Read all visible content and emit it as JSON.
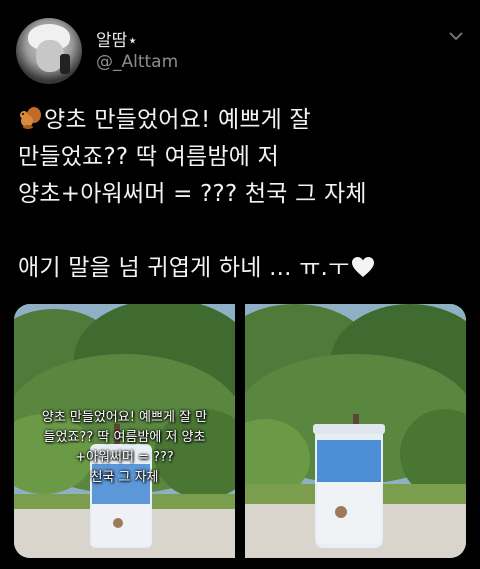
{
  "author": {
    "display_name": "알땀⋆",
    "handle": "@_Alttam"
  },
  "tweet": {
    "line1": "양초 만들었어요! 예쁘게 잘",
    "line2": "만들었죠?? 딱 여름밤에 저",
    "line3": "양초+아워써머 = ??? 천국 그 자체",
    "line4": "애기 말을 넘 귀엽게 하네 ... ㅠ.ㅜ"
  },
  "photos": {
    "overlay_lines": [
      "양초 만들었어요! 예쁘게 잘 만",
      "들었죠?? 딱 여름밤에 저 양초",
      "+아워써머 = ???",
      "천국 그 자체"
    ]
  },
  "colors": {
    "background": "#000000",
    "text": "#f2f2f2",
    "handle": "#8a8d91",
    "candle_blue": "#4d8fd6"
  },
  "icons": [
    "chevron-down-icon",
    "squirrel-emoji-icon",
    "heart-icon"
  ]
}
